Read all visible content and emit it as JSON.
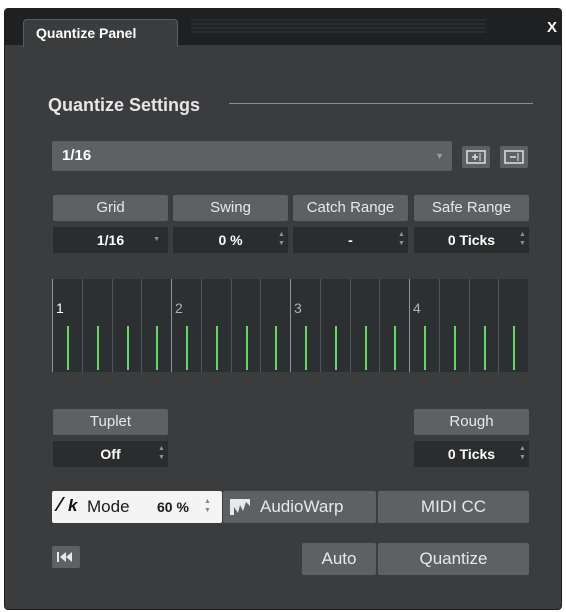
{
  "window": {
    "tab_label": "Quantize Panel",
    "close_label": "X"
  },
  "settings": {
    "section_title": "Quantize Settings",
    "preset_value": "1/16"
  },
  "params": {
    "grid": {
      "label": "Grid",
      "value": "1/16"
    },
    "swing": {
      "label": "Swing",
      "value": "0 %"
    },
    "catch_range": {
      "label": "Catch Range",
      "value": "-"
    },
    "safe_range": {
      "label": "Safe Range",
      "value": "0 Ticks"
    }
  },
  "grid_display": {
    "bar_numbers": [
      "1",
      "2",
      "3",
      "4"
    ],
    "marker_color": "#5fd95f"
  },
  "tuplet": {
    "label": "Tuplet",
    "value": "Off"
  },
  "rough": {
    "label": "Rough",
    "value": "0 Ticks"
  },
  "mode": {
    "label": "Mode",
    "value": "60 %",
    "audiowarp_label": "AudioWarp",
    "midicc_label": "MIDI CC"
  },
  "actions": {
    "auto_label": "Auto",
    "quantize_label": "Quantize"
  },
  "colors": {
    "panel_bg": "#3a3c3e",
    "button_bg": "#5e6164",
    "value_bg": "#2a2c2e",
    "title_bg": "#1f2021"
  }
}
